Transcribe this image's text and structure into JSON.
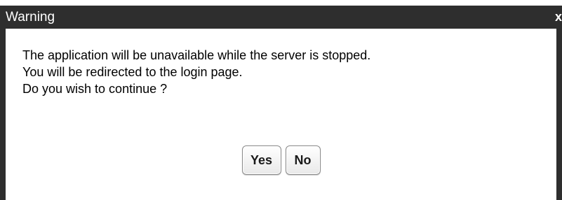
{
  "dialog": {
    "title": "Warning",
    "close_symbol": "x",
    "message_lines": [
      "The application will be unavailable while the server is stopped.",
      "You will be redirected to the login page.",
      "Do you wish to continue ?"
    ],
    "buttons": {
      "yes_label": "Yes",
      "no_label": "No"
    }
  },
  "colors": {
    "titlebar": "#2e2e2e",
    "background": "#ffffff",
    "text": "#000000"
  }
}
